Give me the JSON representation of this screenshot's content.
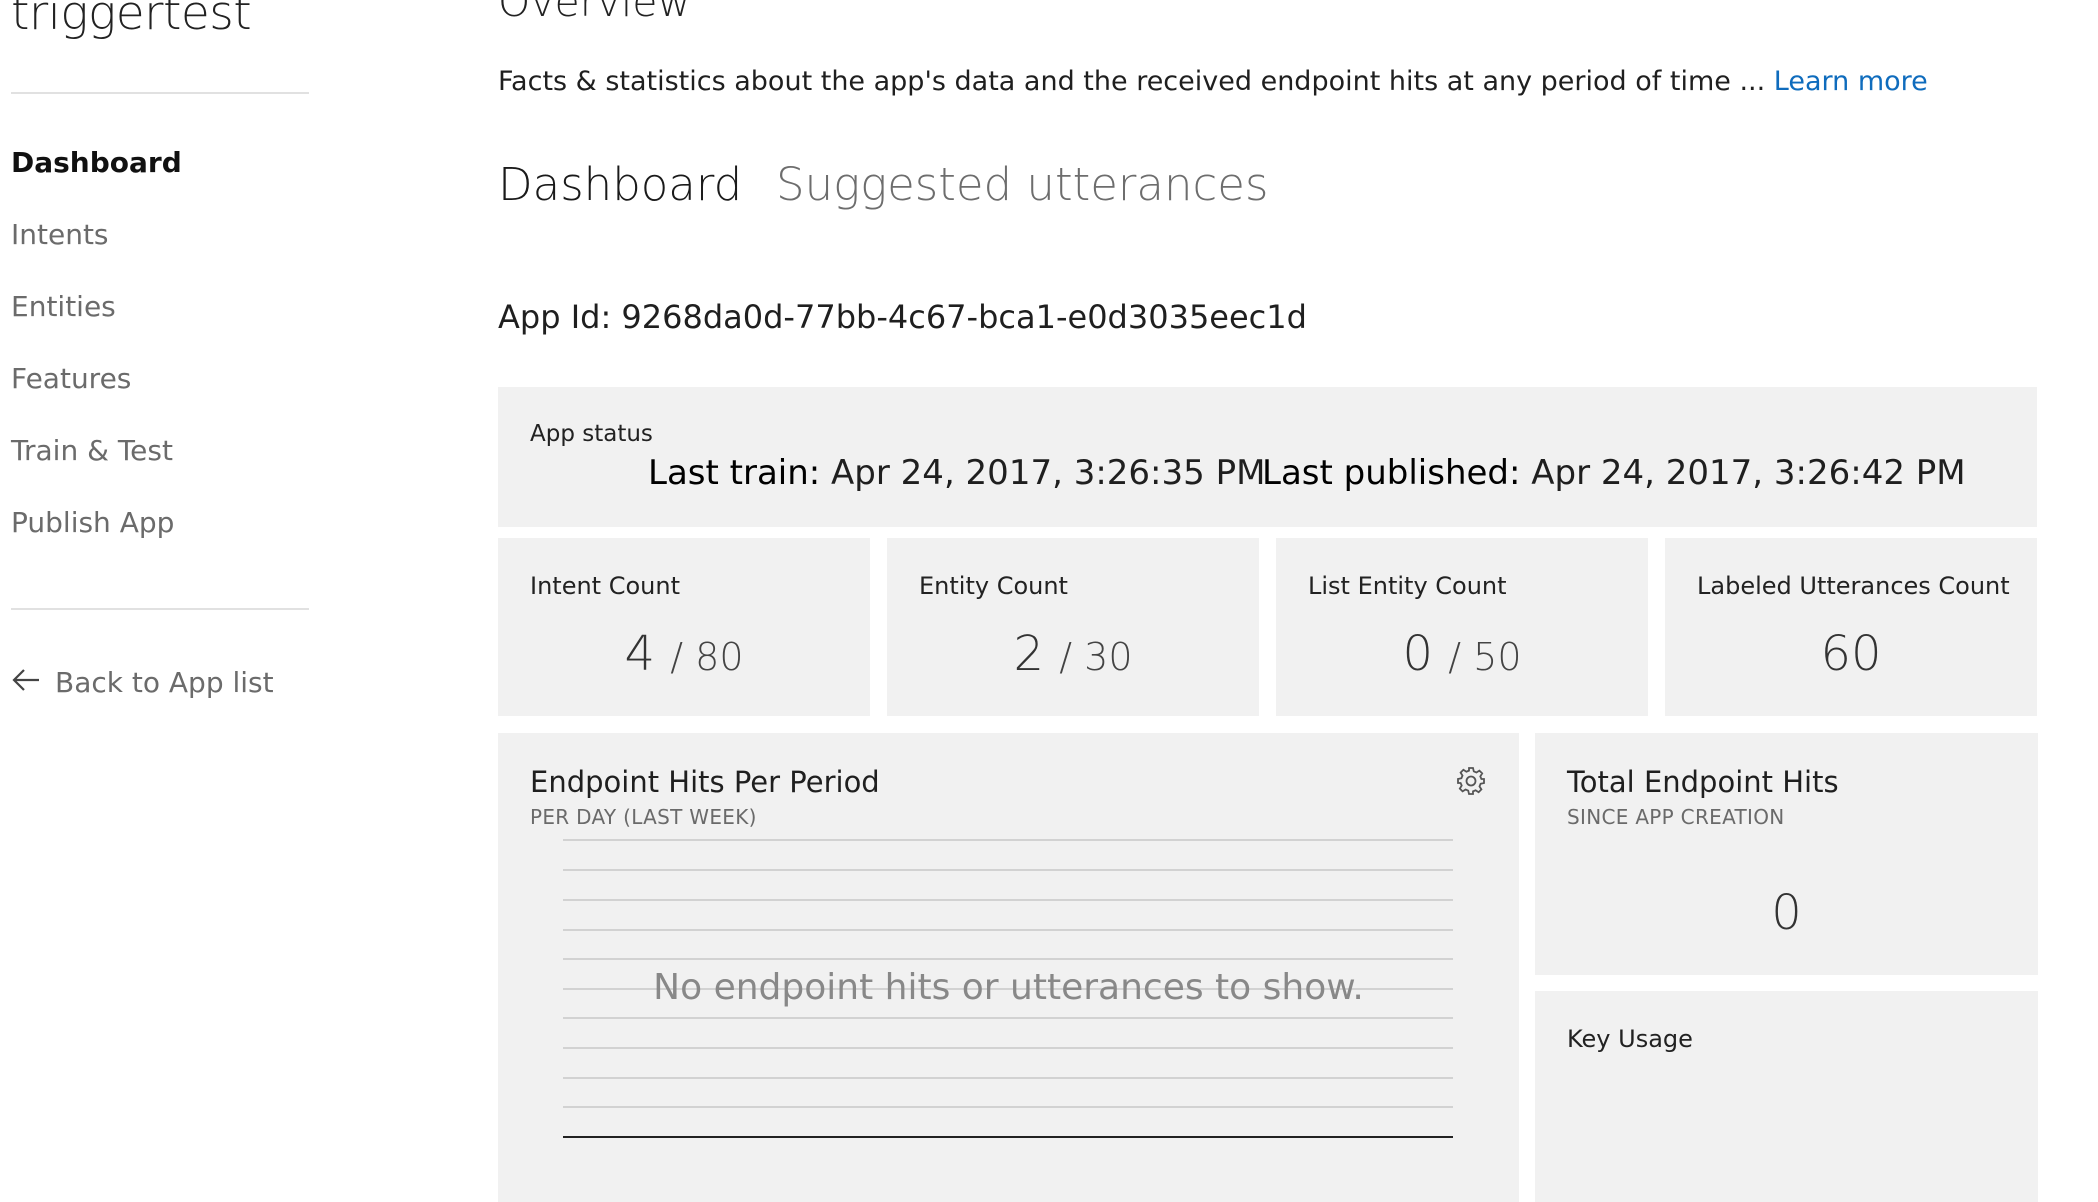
{
  "app": {
    "title": "triggertest"
  },
  "sidebar": {
    "items": [
      {
        "label": "Dashboard",
        "active": true
      },
      {
        "label": "Intents"
      },
      {
        "label": "Entities"
      },
      {
        "label": "Features"
      },
      {
        "label": "Train & Test"
      },
      {
        "label": "Publish App"
      }
    ],
    "back_label": "Back to App list",
    "back_icon": "arrow-left-icon"
  },
  "header": {
    "title": "Overview",
    "description": "Facts & statistics about the app's data and the received endpoint hits at any period of time ...",
    "learn_more": "Learn more"
  },
  "tabs": [
    {
      "label": "Dashboard",
      "active": true
    },
    {
      "label": "Suggested utterances",
      "active": false
    }
  ],
  "app_id": "App Id: 9268da0d-77bb-4c67-bca1-e0d3035eec1d",
  "status": {
    "label": "App status",
    "last_train_label": "Last train:",
    "last_train_value": "Apr 24, 2017, 3:26:35 PM",
    "last_published_label": "Last published:",
    "last_published_value": "Apr 24, 2017, 3:26:42 PM"
  },
  "counts": [
    {
      "label": "Intent Count",
      "value": "4",
      "max": "80"
    },
    {
      "label": "Entity Count",
      "value": "2",
      "max": "30"
    },
    {
      "label": "List Entity Count",
      "value": "0",
      "max": "50"
    },
    {
      "label": "Labeled Utterances Count",
      "value": "60"
    }
  ],
  "endpoint_chart": {
    "title": "Endpoint Hits Per Period",
    "subtitle": "PER DAY (LAST WEEK)",
    "empty_message": "No endpoint hits or utterances to show.",
    "settings_icon": "gear-icon"
  },
  "total_hits": {
    "title": "Total Endpoint Hits",
    "subtitle": "SINCE APP CREATION",
    "value": "0"
  },
  "key_usage": {
    "title": "Key Usage"
  },
  "colors": {
    "panel_bg": "#f1f1f1",
    "link": "#0f6cbd"
  }
}
